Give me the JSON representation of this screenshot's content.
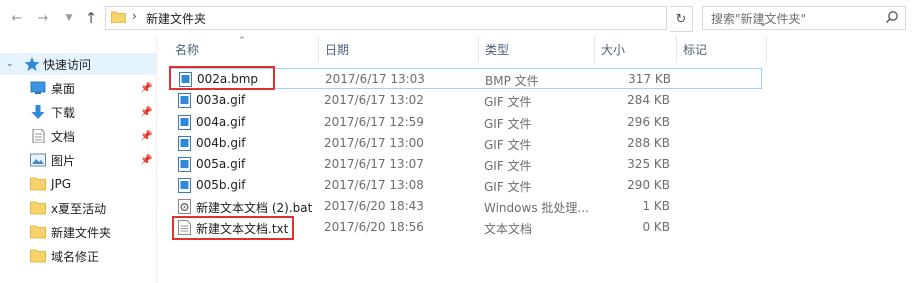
{
  "address": {
    "path": "新建文件夹"
  },
  "search": {
    "placeholder": "搜索\"新建文件夹\""
  },
  "sidebar": {
    "quick_access": "快速访问",
    "items": [
      {
        "label": "桌面",
        "icon": "desktop-icon",
        "pinned": true
      },
      {
        "label": "下载",
        "icon": "download-icon",
        "pinned": true
      },
      {
        "label": "文档",
        "icon": "document-icon",
        "pinned": true
      },
      {
        "label": "图片",
        "icon": "picture-icon",
        "pinned": true
      },
      {
        "label": "JPG",
        "icon": "folder-icon",
        "pinned": false
      },
      {
        "label": "x夏至活动",
        "icon": "folder-icon",
        "pinned": false
      },
      {
        "label": "新建文件夹",
        "icon": "folder-icon",
        "pinned": false
      },
      {
        "label": "域名修正",
        "icon": "folder-icon",
        "pinned": false
      }
    ]
  },
  "columns": {
    "name": "名称",
    "date": "日期",
    "type": "类型",
    "size": "大小",
    "tags": "标记"
  },
  "files": [
    {
      "name": "002a.bmp",
      "date": "2017/6/17 13:03",
      "type": "BMP 文件",
      "size": "317 KB",
      "icon": "image-file-icon"
    },
    {
      "name": "003a.gif",
      "date": "2017/6/17 13:02",
      "type": "GIF 文件",
      "size": "284 KB",
      "icon": "image-file-icon"
    },
    {
      "name": "004a.gif",
      "date": "2017/6/17 12:59",
      "type": "GIF 文件",
      "size": "296 KB",
      "icon": "image-file-icon"
    },
    {
      "name": "004b.gif",
      "date": "2017/6/17 13:00",
      "type": "GIF 文件",
      "size": "288 KB",
      "icon": "image-file-icon"
    },
    {
      "name": "005a.gif",
      "date": "2017/6/17 13:07",
      "type": "GIF 文件",
      "size": "325 KB",
      "icon": "image-file-icon"
    },
    {
      "name": "005b.gif",
      "date": "2017/6/17 13:08",
      "type": "GIF 文件",
      "size": "290 KB",
      "icon": "image-file-icon"
    },
    {
      "name": "新建文本文档 (2).bat",
      "date": "2017/6/20 18:43",
      "type": "Windows 批处理...",
      "size": "1 KB",
      "icon": "batch-file-icon"
    },
    {
      "name": "新建文本文档.txt",
      "date": "2017/6/20 18:56",
      "type": "文本文档",
      "size": "0 KB",
      "icon": "text-file-icon"
    }
  ],
  "colors": {
    "highlight": "#e03030",
    "selection_border": "#99d1ff",
    "quick_access_bg": "#e5f3ff"
  }
}
